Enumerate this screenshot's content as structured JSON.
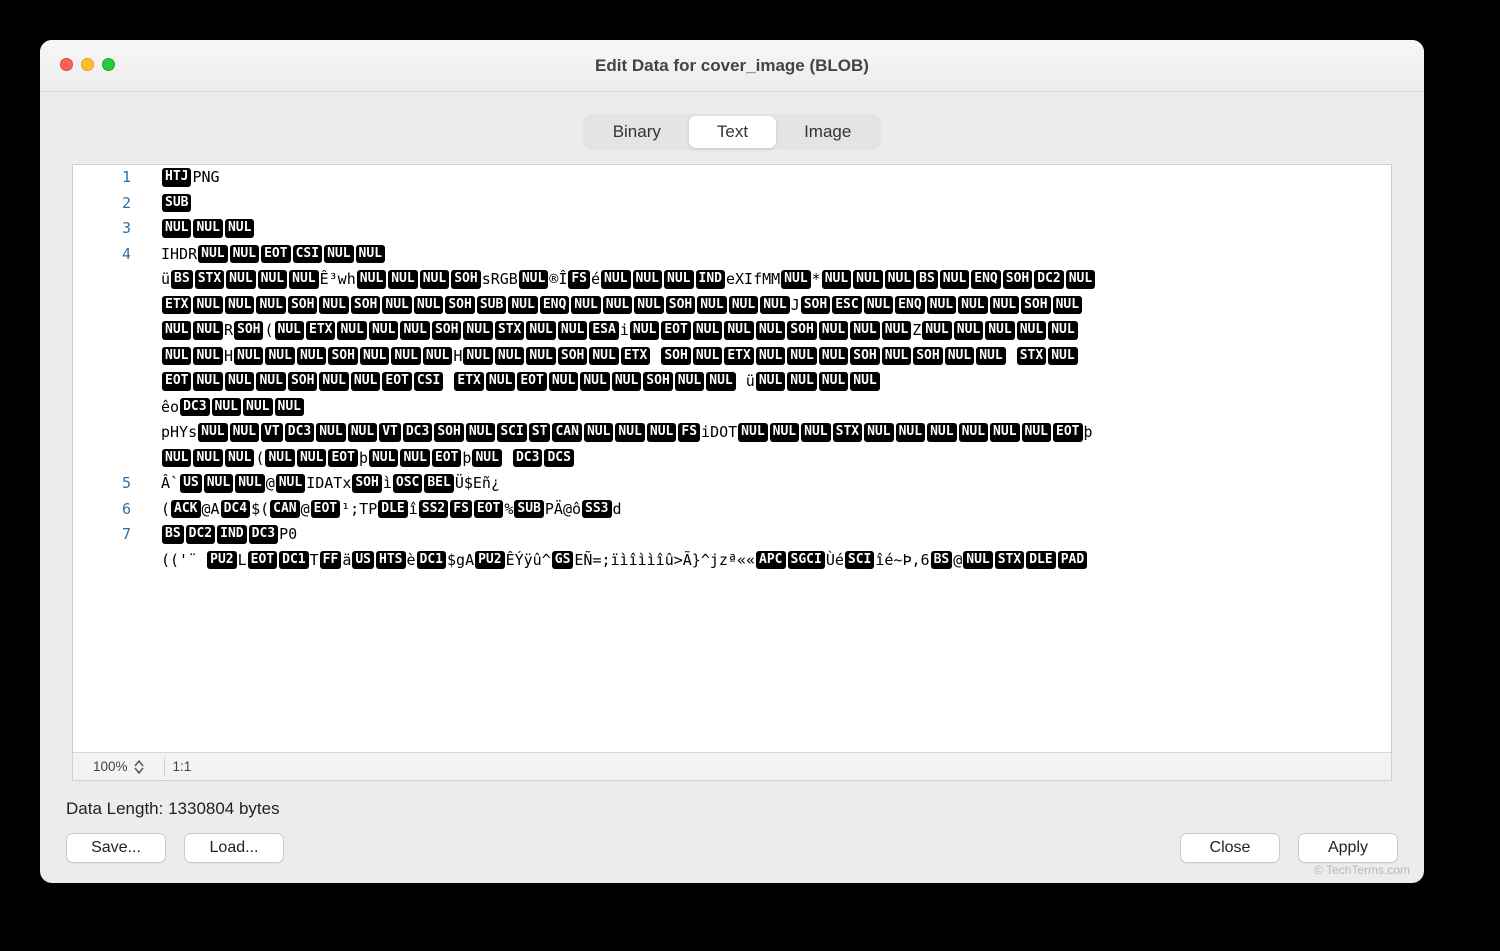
{
  "window": {
    "title": "Edit Data for cover_image (BLOB)"
  },
  "tabs": {
    "binary": "Binary",
    "text": "Text",
    "image": "Image",
    "active": "text"
  },
  "editor": {
    "lines": [
      {
        "n": "1",
        "seq": [
          [
            "c",
            "HTJ"
          ],
          [
            "t",
            "PNG"
          ]
        ]
      },
      {
        "n": "2",
        "seq": [
          [
            "c",
            "SUB"
          ]
        ]
      },
      {
        "n": "3",
        "seq": [
          [
            "c",
            "NUL"
          ],
          [
            "c",
            "NUL"
          ],
          [
            "c",
            "NUL"
          ]
        ]
      },
      {
        "n": "4",
        "seq": [
          [
            "t",
            "IHDR"
          ],
          [
            "c",
            "NUL"
          ],
          [
            "c",
            "NUL"
          ],
          [
            "c",
            "EOT"
          ],
          [
            "c",
            "CSI"
          ],
          [
            "c",
            "NUL"
          ],
          [
            "c",
            "NUL"
          ]
        ]
      },
      {
        "n": "",
        "seq": [
          [
            "t",
            "ü"
          ],
          [
            "c",
            "BS"
          ],
          [
            "c",
            "STX"
          ],
          [
            "c",
            "NUL"
          ],
          [
            "c",
            "NUL"
          ],
          [
            "c",
            "NUL"
          ],
          [
            "t",
            "Ê³wh"
          ],
          [
            "c",
            "NUL"
          ],
          [
            "c",
            "NUL"
          ],
          [
            "c",
            "NUL"
          ],
          [
            "c",
            "SOH"
          ],
          [
            "t",
            "sRGB"
          ],
          [
            "c",
            "NUL"
          ],
          [
            "t",
            "®Î"
          ],
          [
            "c",
            "FS"
          ],
          [
            "t",
            "é"
          ],
          [
            "c",
            "NUL"
          ],
          [
            "c",
            "NUL"
          ],
          [
            "c",
            "NUL"
          ],
          [
            "c",
            "IND"
          ],
          [
            "t",
            "eXIfMM"
          ],
          [
            "c",
            "NUL"
          ],
          [
            "t",
            "*"
          ],
          [
            "c",
            "NUL"
          ],
          [
            "c",
            "NUL"
          ],
          [
            "c",
            "NUL"
          ],
          [
            "c",
            "BS"
          ],
          [
            "c",
            "NUL"
          ],
          [
            "c",
            "ENQ"
          ],
          [
            "c",
            "SOH"
          ],
          [
            "c",
            "DC2"
          ],
          [
            "c",
            "NUL"
          ]
        ]
      },
      {
        "n": "",
        "seq": [
          [
            "c",
            "ETX"
          ],
          [
            "c",
            "NUL"
          ],
          [
            "c",
            "NUL"
          ],
          [
            "c",
            "NUL"
          ],
          [
            "c",
            "SOH"
          ],
          [
            "c",
            "NUL"
          ],
          [
            "c",
            "SOH"
          ],
          [
            "c",
            "NUL"
          ],
          [
            "c",
            "NUL"
          ],
          [
            "c",
            "SOH"
          ],
          [
            "c",
            "SUB"
          ],
          [
            "c",
            "NUL"
          ],
          [
            "c",
            "ENQ"
          ],
          [
            "c",
            "NUL"
          ],
          [
            "c",
            "NUL"
          ],
          [
            "c",
            "NUL"
          ],
          [
            "c",
            "SOH"
          ],
          [
            "c",
            "NUL"
          ],
          [
            "c",
            "NUL"
          ],
          [
            "c",
            "NUL"
          ],
          [
            "t",
            "J"
          ],
          [
            "c",
            "SOH"
          ],
          [
            "c",
            "ESC"
          ],
          [
            "c",
            "NUL"
          ],
          [
            "c",
            "ENQ"
          ],
          [
            "c",
            "NUL"
          ],
          [
            "c",
            "NUL"
          ],
          [
            "c",
            "NUL"
          ],
          [
            "c",
            "SOH"
          ],
          [
            "c",
            "NUL"
          ]
        ]
      },
      {
        "n": "",
        "seq": [
          [
            "c",
            "NUL"
          ],
          [
            "c",
            "NUL"
          ],
          [
            "t",
            "R"
          ],
          [
            "c",
            "SOH"
          ],
          [
            "t",
            "("
          ],
          [
            "c",
            "NUL"
          ],
          [
            "c",
            "ETX"
          ],
          [
            "c",
            "NUL"
          ],
          [
            "c",
            "NUL"
          ],
          [
            "c",
            "NUL"
          ],
          [
            "c",
            "SOH"
          ],
          [
            "c",
            "NUL"
          ],
          [
            "c",
            "STX"
          ],
          [
            "c",
            "NUL"
          ],
          [
            "c",
            "NUL"
          ],
          [
            "c",
            "ESA"
          ],
          [
            "t",
            "i"
          ],
          [
            "c",
            "NUL"
          ],
          [
            "c",
            "EOT"
          ],
          [
            "c",
            "NUL"
          ],
          [
            "c",
            "NUL"
          ],
          [
            "c",
            "NUL"
          ],
          [
            "c",
            "SOH"
          ],
          [
            "c",
            "NUL"
          ],
          [
            "c",
            "NUL"
          ],
          [
            "c",
            "NUL"
          ],
          [
            "t",
            "Z"
          ],
          [
            "c",
            "NUL"
          ],
          [
            "c",
            "NUL"
          ],
          [
            "c",
            "NUL"
          ],
          [
            "c",
            "NUL"
          ],
          [
            "c",
            "NUL"
          ]
        ]
      },
      {
        "n": "",
        "seq": [
          [
            "c",
            "NUL"
          ],
          [
            "c",
            "NUL"
          ],
          [
            "t",
            "H"
          ],
          [
            "c",
            "NUL"
          ],
          [
            "c",
            "NUL"
          ],
          [
            "c",
            "NUL"
          ],
          [
            "c",
            "SOH"
          ],
          [
            "c",
            "NUL"
          ],
          [
            "c",
            "NUL"
          ],
          [
            "c",
            "NUL"
          ],
          [
            "t",
            "H"
          ],
          [
            "c",
            "NUL"
          ],
          [
            "c",
            "NUL"
          ],
          [
            "c",
            "NUL"
          ],
          [
            "c",
            "SOH"
          ],
          [
            "c",
            "NUL"
          ],
          [
            "c",
            "ETX"
          ],
          [
            "t",
            " "
          ],
          [
            "c",
            "SOH"
          ],
          [
            "c",
            "NUL"
          ],
          [
            "c",
            "ETX"
          ],
          [
            "c",
            "NUL"
          ],
          [
            "c",
            "NUL"
          ],
          [
            "c",
            "NUL"
          ],
          [
            "c",
            "SOH"
          ],
          [
            "c",
            "NUL"
          ],
          [
            "c",
            "SOH"
          ],
          [
            "c",
            "NUL"
          ],
          [
            "c",
            "NUL"
          ],
          [
            "t",
            " "
          ],
          [
            "c",
            "STX"
          ],
          [
            "c",
            "NUL"
          ]
        ]
      },
      {
        "n": "",
        "seq": [
          [
            "c",
            "EOT"
          ],
          [
            "c",
            "NUL"
          ],
          [
            "c",
            "NUL"
          ],
          [
            "c",
            "NUL"
          ],
          [
            "c",
            "SOH"
          ],
          [
            "c",
            "NUL"
          ],
          [
            "c",
            "NUL"
          ],
          [
            "c",
            "EOT"
          ],
          [
            "c",
            "CSI"
          ],
          [
            "t",
            " "
          ],
          [
            "c",
            "ETX"
          ],
          [
            "c",
            "NUL"
          ],
          [
            "c",
            "EOT"
          ],
          [
            "c",
            "NUL"
          ],
          [
            "c",
            "NUL"
          ],
          [
            "c",
            "NUL"
          ],
          [
            "c",
            "SOH"
          ],
          [
            "c",
            "NUL"
          ],
          [
            "c",
            "NUL"
          ],
          [
            "t",
            "    ü"
          ],
          [
            "c",
            "NUL"
          ],
          [
            "c",
            "NUL"
          ],
          [
            "c",
            "NUL"
          ],
          [
            "c",
            "NUL"
          ]
        ]
      },
      {
        "n": "",
        "seq": [
          [
            "t",
            "êo"
          ],
          [
            "c",
            "DC3"
          ],
          [
            "c",
            "NUL"
          ],
          [
            "c",
            "NUL"
          ],
          [
            "c",
            "NUL"
          ]
        ]
      },
      {
        "n": "",
        "seq": [
          [
            "t",
            "pHYs"
          ],
          [
            "c",
            "NUL"
          ],
          [
            "c",
            "NUL"
          ],
          [
            "c",
            "VT"
          ],
          [
            "c",
            "DC3"
          ],
          [
            "c",
            "NUL"
          ],
          [
            "c",
            "NUL"
          ],
          [
            "c",
            "VT"
          ],
          [
            "c",
            "DC3"
          ],
          [
            "c",
            "SOH"
          ],
          [
            "c",
            "NUL"
          ],
          [
            "c",
            "SCI"
          ],
          [
            "c",
            "ST"
          ],
          [
            "c",
            "CAN"
          ],
          [
            "c",
            "NUL"
          ],
          [
            "c",
            "NUL"
          ],
          [
            "c",
            "NUL"
          ],
          [
            "c",
            "FS"
          ],
          [
            "t",
            "iDOT"
          ],
          [
            "c",
            "NUL"
          ],
          [
            "c",
            "NUL"
          ],
          [
            "c",
            "NUL"
          ],
          [
            "c",
            "STX"
          ],
          [
            "c",
            "NUL"
          ],
          [
            "c",
            "NUL"
          ],
          [
            "c",
            "NUL"
          ],
          [
            "c",
            "NUL"
          ],
          [
            "c",
            "NUL"
          ],
          [
            "c",
            "NUL"
          ],
          [
            "c",
            "EOT"
          ],
          [
            "t",
            "þ"
          ]
        ]
      },
      {
        "n": "",
        "seq": [
          [
            "c",
            "NUL"
          ],
          [
            "c",
            "NUL"
          ],
          [
            "c",
            "NUL"
          ],
          [
            "t",
            "("
          ],
          [
            "c",
            "NUL"
          ],
          [
            "c",
            "NUL"
          ],
          [
            "c",
            "EOT"
          ],
          [
            "t",
            "þ"
          ],
          [
            "c",
            "NUL"
          ],
          [
            "c",
            "NUL"
          ],
          [
            "c",
            "EOT"
          ],
          [
            "t",
            "þ"
          ],
          [
            "c",
            "NUL"
          ],
          [
            "t",
            "     "
          ],
          [
            "c",
            "DC3"
          ],
          [
            "c",
            "DCS"
          ]
        ]
      },
      {
        "n": "5",
        "seq": [
          [
            "t",
            "Â`"
          ],
          [
            "c",
            "US"
          ],
          [
            "c",
            "NUL"
          ],
          [
            "c",
            "NUL"
          ],
          [
            "t",
            "@"
          ],
          [
            "c",
            "NUL"
          ],
          [
            "t",
            "IDATx"
          ],
          [
            "c",
            "SOH"
          ],
          [
            "t",
            "ì"
          ],
          [
            "c",
            "OSC"
          ],
          [
            "c",
            "BEL"
          ],
          [
            "t",
            "Ü$Eñ¿"
          ]
        ]
      },
      {
        "n": "6",
        "seq": [
          [
            "t",
            "("
          ],
          [
            "c",
            "ACK"
          ],
          [
            "t",
            "@A"
          ],
          [
            "c",
            "DC4"
          ],
          [
            "t",
            "$("
          ],
          [
            "c",
            "CAN"
          ],
          [
            "t",
            "@"
          ],
          [
            "c",
            "EOT"
          ],
          [
            "t",
            "¹;TP"
          ],
          [
            "c",
            "DLE"
          ],
          [
            "t",
            "î"
          ],
          [
            "c",
            "SS2"
          ],
          [
            "c",
            "FS"
          ],
          [
            "c",
            "EOT"
          ],
          [
            "t",
            "%"
          ],
          [
            "c",
            "SUB"
          ],
          [
            "t",
            "PÄ@ô"
          ],
          [
            "c",
            "SS3"
          ],
          [
            "t",
            "d"
          ]
        ]
      },
      {
        "n": "7",
        "seq": [
          [
            "c",
            "BS"
          ],
          [
            "c",
            "DC2"
          ],
          [
            "c",
            "IND"
          ],
          [
            "c",
            "DC3"
          ],
          [
            "t",
            "P0"
          ]
        ]
      },
      {
        "n": "",
        "seq": [
          [
            "t",
            "(('¨ "
          ],
          [
            "c",
            "PU2"
          ],
          [
            "t",
            "L"
          ],
          [
            "c",
            "EOT"
          ],
          [
            "c",
            "DC1"
          ],
          [
            "t",
            "T"
          ],
          [
            "c",
            "FF"
          ],
          [
            "t",
            "ä"
          ],
          [
            "c",
            "US"
          ],
          [
            "c",
            "HTS"
          ],
          [
            "t",
            "è"
          ],
          [
            "c",
            "DC1"
          ],
          [
            "t",
            "$gA"
          ],
          [
            "c",
            "PU2"
          ],
          [
            "t",
            "ÊÝÿû^"
          ],
          [
            "c",
            "GS"
          ],
          [
            "t",
            "EÑ=;ïìîììîû>Ã}^jzª««"
          ],
          [
            "c",
            "APC"
          ],
          [
            "c",
            "SGCI"
          ],
          [
            "t",
            "Ùé"
          ],
          [
            "c",
            "SCI"
          ],
          [
            "t",
            "îé~Þ,6"
          ],
          [
            "c",
            "BS"
          ],
          [
            "t",
            "@"
          ],
          [
            "c",
            "NUL"
          ],
          [
            "c",
            "STX"
          ],
          [
            "c",
            "DLE"
          ],
          [
            "c",
            "PAD"
          ]
        ]
      }
    ],
    "zoom": "100%",
    "cursor": "1:1"
  },
  "status": {
    "data_length": "Data Length: 1330804 bytes"
  },
  "buttons": {
    "save": "Save...",
    "load": "Load...",
    "close": "Close",
    "apply": "Apply"
  },
  "watermark": "© TechTerms.com"
}
